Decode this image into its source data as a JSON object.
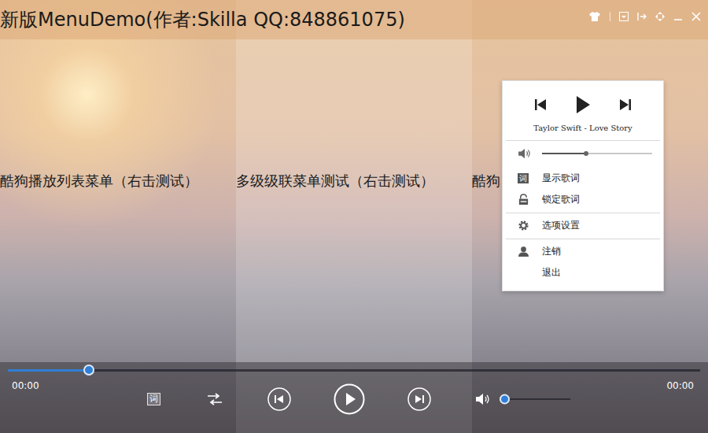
{
  "window": {
    "title": "新版MenuDemo(作者:Skilla QQ:848861075)"
  },
  "demo_labels": [
    "酷狗播放列表菜单（右击测试）",
    "多级级联菜单测试（右击测试）",
    "酷狗"
  ],
  "context_menu": {
    "song": "Taylor Swift - Love Story",
    "volume": {
      "level": 0.4
    },
    "groups": [
      [
        {
          "label": "显示歌词",
          "icon_text": "词"
        },
        {
          "label": "锁定歌词",
          "icon_text": ""
        }
      ],
      [
        {
          "label": "选项设置",
          "icon_text": ""
        }
      ],
      [
        {
          "label": "注销",
          "icon_text": ""
        },
        {
          "label": "退出",
          "icon_text": ""
        }
      ]
    ]
  },
  "player": {
    "progress": {
      "level": 0.117
    },
    "elapsed": "00:00",
    "duration": "00:00",
    "lyrics_button": "词",
    "volume": {
      "level": 0.0
    }
  }
}
